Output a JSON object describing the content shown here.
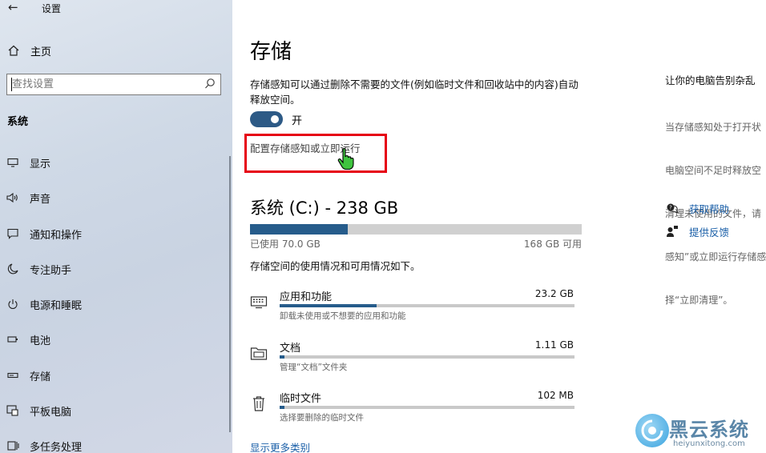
{
  "window": {
    "title": "设置"
  },
  "sidebar": {
    "home_label": "主页",
    "search_placeholder": "查找设置",
    "section_label": "系统",
    "items": [
      {
        "label": "显示",
        "icon": "display-icon"
      },
      {
        "label": "声音",
        "icon": "speaker-icon"
      },
      {
        "label": "通知和操作",
        "icon": "notification-icon"
      },
      {
        "label": "专注助手",
        "icon": "moon-icon"
      },
      {
        "label": "电源和睡眠",
        "icon": "power-icon"
      },
      {
        "label": "电池",
        "icon": "battery-icon"
      },
      {
        "label": "存储",
        "icon": "storage-icon"
      },
      {
        "label": "平板电脑",
        "icon": "tablet-icon"
      },
      {
        "label": "多任务处理",
        "icon": "multitask-icon"
      }
    ]
  },
  "main": {
    "title": "存储",
    "description": "存储感知可以通过删除不需要的文件(例如临时文件和回收站中的内容)自动释放空间。",
    "toggle": {
      "state": "on",
      "label": "开"
    },
    "config_link": "配置存储感知或立即运行",
    "drive": {
      "title": "系统 (C:) - 238 GB",
      "used_label": "已使用 70.0 GB",
      "free_label": "168 GB 可用",
      "used_fraction": 0.294
    },
    "usage_description": "存储空间的使用情况和可用情况如下。",
    "categories": [
      {
        "name": "应用和功能",
        "size": "23.2 GB",
        "subtitle": "卸载未使用或不想要的应用和功能",
        "fraction": 0.33,
        "icon": "apps-icon"
      },
      {
        "name": "文档",
        "size": "1.11 GB",
        "subtitle": "管理“文档”文件夹",
        "fraction": 0.016,
        "icon": "documents-icon"
      },
      {
        "name": "临时文件",
        "size": "102 MB",
        "subtitle": "选择要删除的临时文件",
        "fraction": 0.005,
        "icon": "trash-icon"
      }
    ],
    "more_link": "显示更多类别"
  },
  "right": {
    "heading": "让你的电脑告别杂乱",
    "text_lines": [
      "当存储感知处于打开状",
      "电脑空间不足时释放空",
      "清理未使用的文件，请",
      "感知”或立即运行存储感",
      "择“立即清理”。"
    ],
    "help_label": "获取帮助",
    "feedback_label": "提供反馈"
  },
  "watermark": {
    "name": "黑云系统",
    "url": "heiyunxitong.com"
  },
  "colors": {
    "accent": "#265c8b",
    "link": "#1a5fa8",
    "highlight": "#e60012"
  }
}
